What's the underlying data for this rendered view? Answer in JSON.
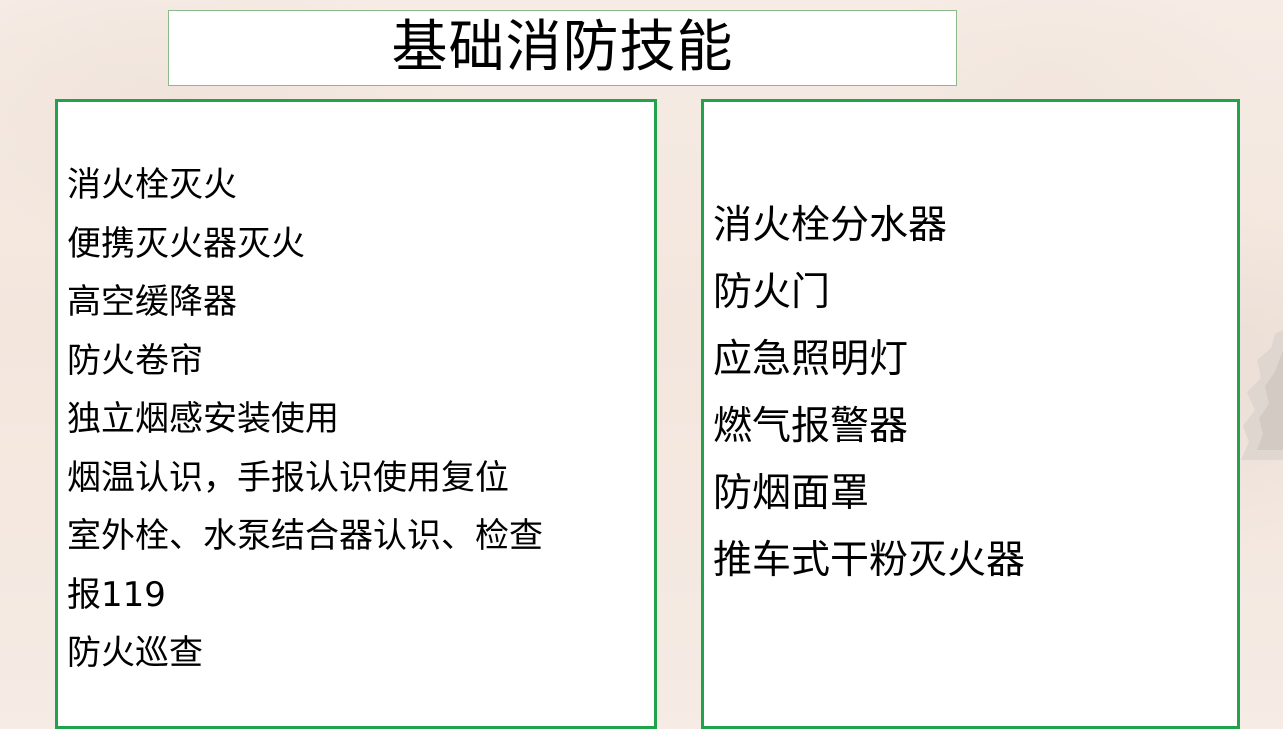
{
  "slide": {
    "title": "基础消防技能",
    "accent_color": "#22a24a",
    "left_panel": {
      "items": [
        "消火栓灭火",
        "便携灭火器灭火",
        "高空缓降器",
        "防火卷帘",
        "独立烟感安装使用",
        "烟温认识，手报认识使用复位",
        "室外栓、水泵结合器认识、检查",
        "报119",
        "防火巡查"
      ]
    },
    "right_panel": {
      "items": [
        "消火栓分水器",
        "防火门",
        "应急照明灯",
        "燃气报警器",
        "防烟面罩",
        "推车式干粉灭火器"
      ]
    }
  }
}
